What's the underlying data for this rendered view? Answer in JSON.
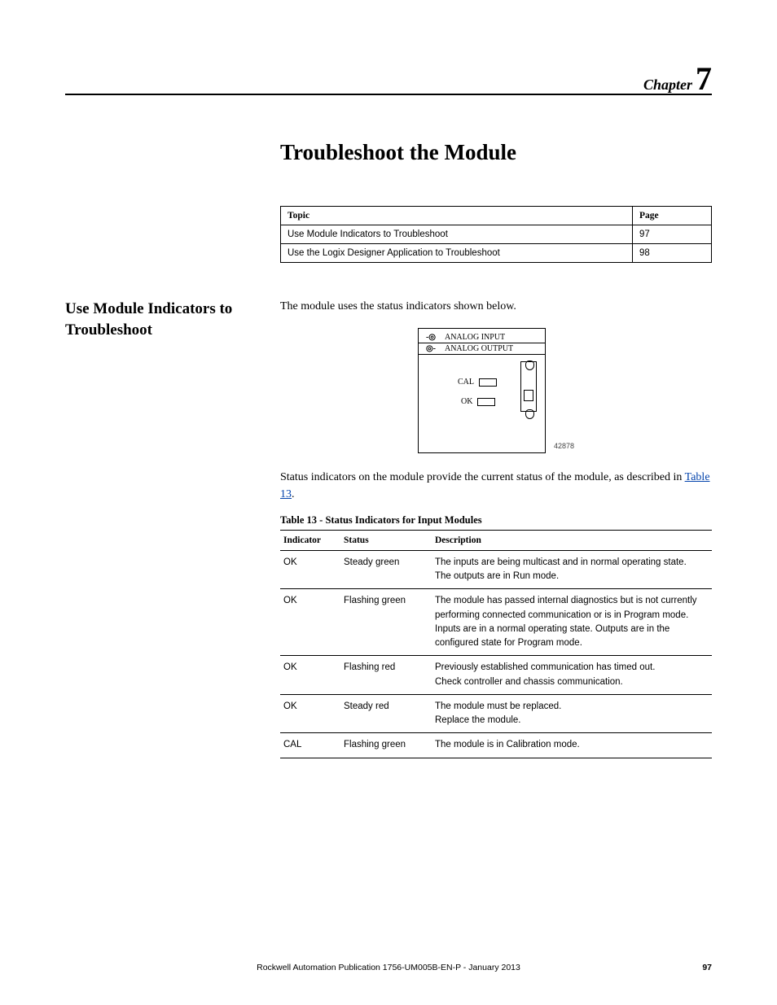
{
  "chapter": {
    "label": "Chapter",
    "number": "7"
  },
  "title": "Troubleshoot the Module",
  "topic_table": {
    "headers": [
      "Topic",
      "Page"
    ],
    "rows": [
      {
        "topic": "Use Module Indicators to Troubleshoot",
        "page": "97"
      },
      {
        "topic": "Use the Logix Designer Application to Troubleshoot",
        "page": "98"
      }
    ]
  },
  "section_heading": "Use Module Indicators to Troubleshoot",
  "intro_text": "The module uses the status indicators shown below.",
  "diagram": {
    "row1": "ANALOG INPUT",
    "row2": "ANALOG OUTPUT",
    "cal": "CAL",
    "ok": "OK",
    "id": "42878"
  },
  "para2_a": "Status indicators on the module provide the current status of the module, as described in ",
  "para2_link": "Table 13",
  "para2_b": ".",
  "table_caption": "Table 13 - Status Indicators for Input Modules",
  "status_table": {
    "headers": [
      "Indicator",
      "Status",
      "Description"
    ],
    "rows": [
      {
        "ind": "OK",
        "stat": "Steady green",
        "desc": "The inputs are being multicast and in normal operating state.\nThe outputs are in Run mode."
      },
      {
        "ind": "OK",
        "stat": "Flashing green",
        "desc": "The module has passed internal diagnostics but is not currently performing connected communication or is in Program mode. Inputs are in a normal operating state. Outputs are in the configured state for Program mode."
      },
      {
        "ind": "OK",
        "stat": "Flashing red",
        "desc": "Previously established communication has timed out.\nCheck controller and chassis communication."
      },
      {
        "ind": "OK",
        "stat": "Steady red",
        "desc": "The module must be replaced.\nReplace the module."
      },
      {
        "ind": "CAL",
        "stat": "Flashing green",
        "desc": "The module is in Calibration mode."
      }
    ]
  },
  "footer": {
    "pub": "Rockwell Automation Publication 1756-UM005B-EN-P - January 2013",
    "page": "97"
  }
}
